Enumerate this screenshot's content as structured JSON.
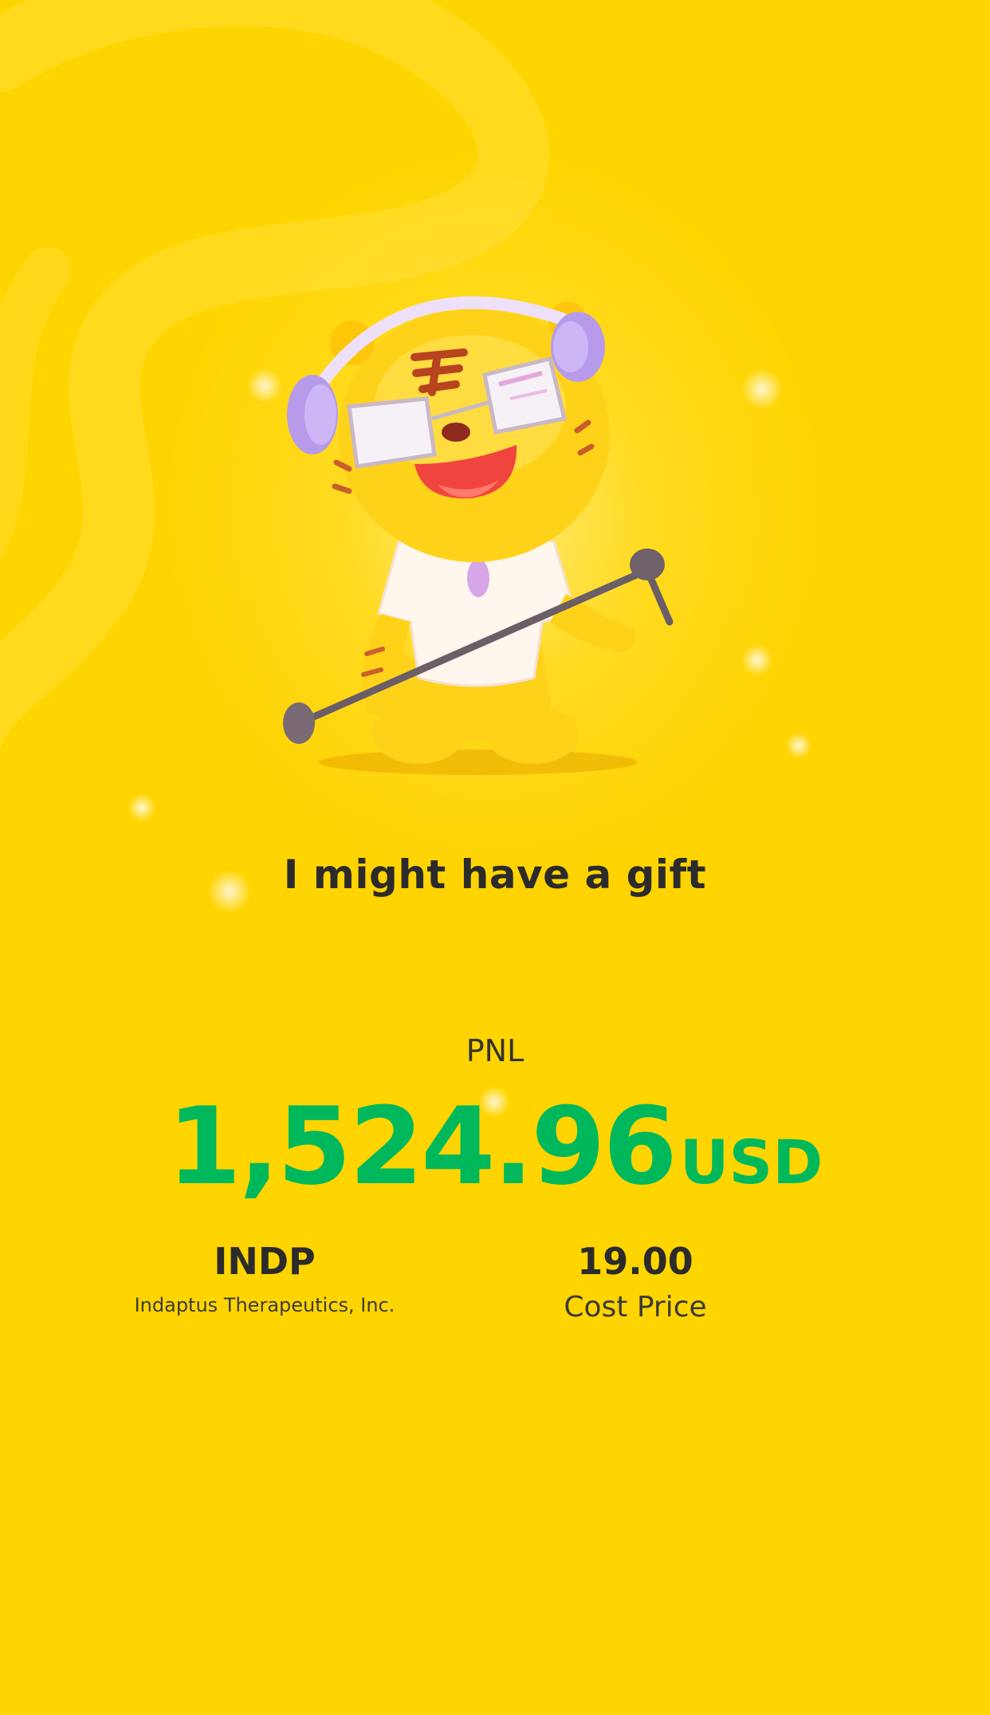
{
  "card": {
    "tagline": "I might have a gift",
    "pnl_label": "PNL",
    "pnl_amount": "1,524.96",
    "pnl_unit": "USD",
    "symbol": "INDP",
    "company": "Indaptus Therapeutics, Inc.",
    "cost_value": "19.00",
    "cost_label": "Cost Price"
  },
  "colors": {
    "background": "#FFD500",
    "positive": "#00B85C",
    "text": "#2b2b2b"
  },
  "mascot": {
    "icon": "tiger-mascot-with-headphones-and-microphone-icon"
  }
}
